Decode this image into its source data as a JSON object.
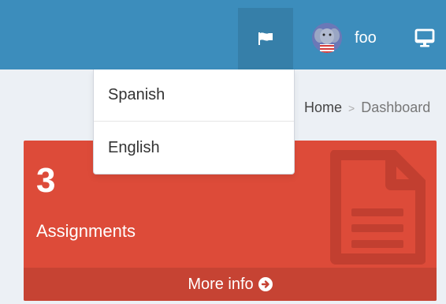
{
  "topbar": {
    "flag_icon": "flag-icon",
    "user": {
      "name": "foo",
      "avatar_icon": "elephant-avatar"
    },
    "monitor_icon": "monitor-icon"
  },
  "language_menu": {
    "items": [
      {
        "label": "Spanish"
      },
      {
        "label": "English"
      }
    ]
  },
  "breadcrumb": {
    "home": "Home",
    "separator": ">",
    "current": "Dashboard"
  },
  "card": {
    "count": "3",
    "label": "Assignments",
    "icon": "file-text-icon",
    "footer_label": "More info",
    "footer_icon": "arrow-circle-right-icon",
    "color": "#dd4b39"
  },
  "colors": {
    "topbar": "#3c8dbc",
    "active_nav": "#367fa9",
    "background": "#ecf0f5",
    "card_footer": "#c64333"
  }
}
